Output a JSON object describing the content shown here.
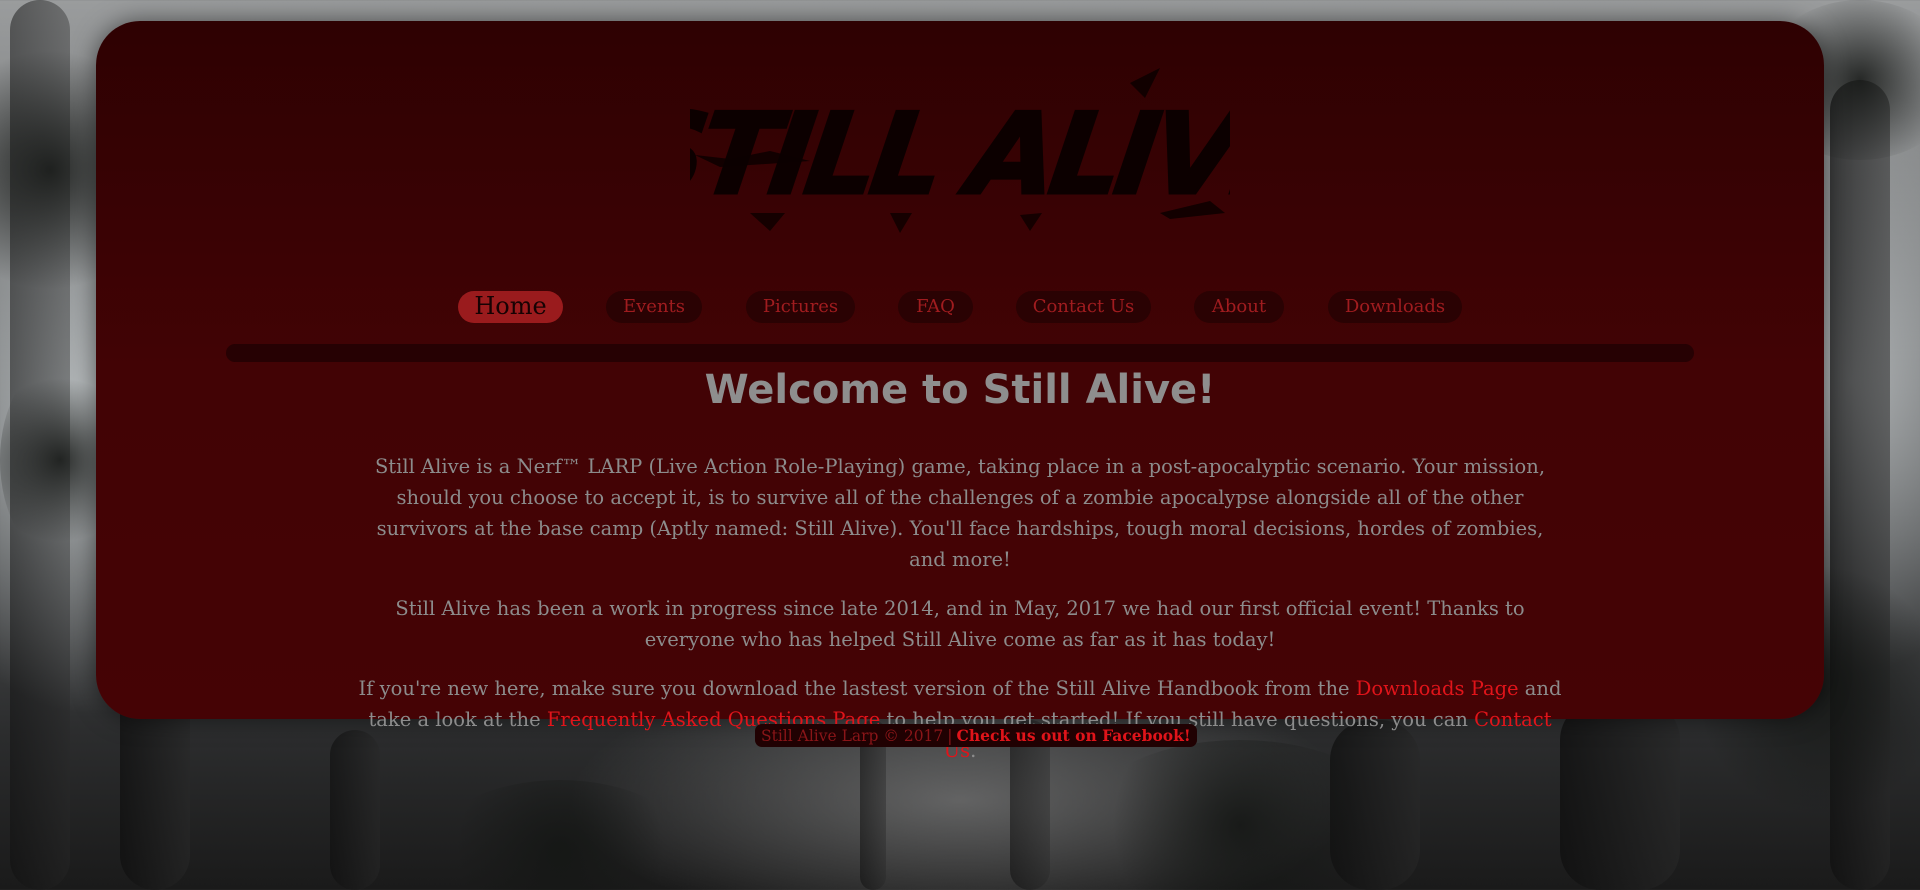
{
  "site": {
    "logo_text": "STILL ALIVE"
  },
  "nav": {
    "items": [
      {
        "label": "Home"
      },
      {
        "label": "Events"
      },
      {
        "label": "Pictures"
      },
      {
        "label": "FAQ"
      },
      {
        "label": "Contact Us"
      },
      {
        "label": "About"
      },
      {
        "label": "Downloads"
      }
    ],
    "active": "Home"
  },
  "main": {
    "title": "Welcome to Still Alive!",
    "p1": "Still Alive is a Nerf™ LARP (Live Action Role-Playing) game, taking place in a post-apocalyptic scenario. Your mission, should you choose to accept it, is to survive all of the challenges of a zombie apocalypse alongside all of the other survivors at the base camp (Aptly named: Still Alive). You'll face hardships, tough moral decisions, hordes of zombies, and more!",
    "p2": "Still Alive has been a work in progress since late 2014, and in May, 2017 we had our first official event! Thanks to everyone who has helped Still Alive come as far as it has today!",
    "p3_part1": "If you're new here, make sure you download the lastest version of the Still Alive Handbook from the ",
    "p3_link1": "Downloads Page",
    "p3_part2": " and take a look at the ",
    "p3_link2": "Frequently Asked Questions Page",
    "p3_part3": " to help you get started! If you still have questions, you can ",
    "p3_link3": "Contact Us",
    "p3_part4": "."
  },
  "footer": {
    "copyright": "Still Alive Larp © 2017",
    "separator": "|",
    "facebook_link": "Check us out on Facebook!"
  },
  "colors": {
    "panel": "#420305",
    "link": "#e0141a",
    "nav_active": "#9a1b1d",
    "text": "#8c8c8c"
  }
}
